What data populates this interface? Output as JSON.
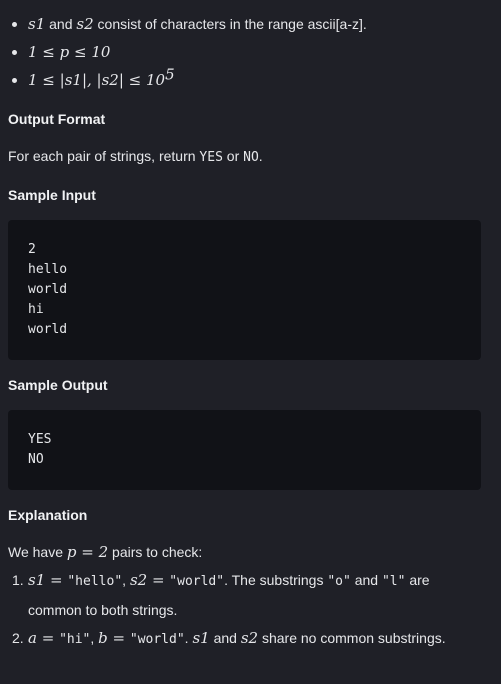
{
  "constraints": {
    "c1": {
      "m1": "s1",
      "t1": " and ",
      "m2": "s2",
      "t2": " consist of characters in the range ascii[a-z]."
    },
    "c2": {
      "expr": "1 ≤ p ≤ 10"
    },
    "c3": {
      "expr": "1 ≤ |s1|, |s2| ≤ 10",
      "exp": "5"
    }
  },
  "output_format": {
    "heading": "Output Format",
    "text_before": "For each pair of strings, return ",
    "yes": "YES",
    "text_mid": " or ",
    "no": "NO",
    "text_after": "."
  },
  "sample_input": {
    "heading": "Sample Input",
    "lines": [
      "2",
      "hello",
      "world",
      "hi",
      "world"
    ]
  },
  "sample_output": {
    "heading": "Sample Output",
    "lines": [
      "YES",
      "NO"
    ]
  },
  "explanation": {
    "heading": "Explanation",
    "intro_before": "We have ",
    "intro_math": "p = 2",
    "intro_after": " pairs to check:",
    "item1": {
      "num": "1.",
      "m1": "s1 = ",
      "v1": "\"hello\"",
      "sep1": ", ",
      "m2": "s2 = ",
      "v2": "\"world\"",
      "t1": ". The substrings ",
      "c1": "\"o\"",
      "t2": " and ",
      "c2": "\"l\"",
      "t3": " are common to both strings."
    },
    "item2": {
      "num": "2.",
      "m1": "a = ",
      "v1": "\"hi\"",
      "sep1": ", ",
      "m2": "b = ",
      "v2": "\"world\"",
      "t1": ". ",
      "m3": "s1",
      "t2": " and ",
      "m4": "s2",
      "t3": " share no common substrings."
    }
  }
}
